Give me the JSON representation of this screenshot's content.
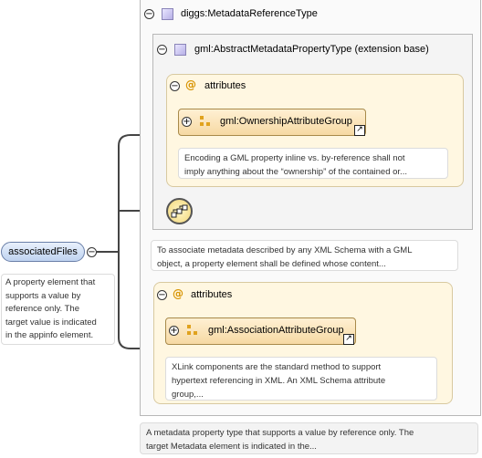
{
  "root_element": {
    "name": "associatedFiles",
    "doc": [
      "A property element that",
      "supports a value by",
      "reference only. The",
      "target value is indicated",
      "in the appinfo element."
    ]
  },
  "type": {
    "title": "diggs:MetadataReferenceType",
    "doc": [
      "A metadata property type that supports a value by reference only. The",
      "target Metadata element is indicated in the..."
    ]
  },
  "extension": {
    "title": "gml:AbstractMetadataPropertyType (extension base)",
    "attributes_label": "attributes",
    "group_name": "gml:OwnershipAttributeGroup",
    "group_doc": [
      "Encoding a GML property inline vs. by-reference shall not",
      "imply anything about the “ownership” of the contained or..."
    ]
  },
  "extension_doc": [
    "To associate metadata described by any XML Schema with a GML",
    "object, a property element shall be defined whose content..."
  ],
  "attributes2": {
    "label": "attributes",
    "group_name": "gml:AssociationAttributeGroup",
    "group_doc": [
      "XLink components are the standard method to support",
      "hypertext referencing in XML. An XML Schema attribute",
      "group,..."
    ]
  },
  "icons": {
    "collapse": "−",
    "expand": "+",
    "at": "@",
    "ext_link": "↗"
  },
  "colors": {
    "element_fill": "#cfe0f7",
    "attr_fill": "#fff5dc",
    "group_fill": "#fde7bf",
    "connector": "#444444"
  }
}
